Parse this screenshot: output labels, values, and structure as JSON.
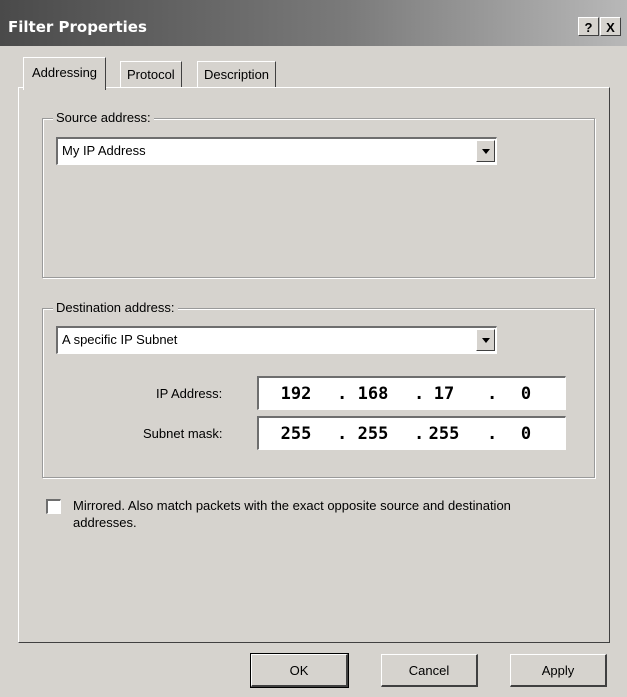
{
  "window": {
    "title": "Filter Properties",
    "help_label": "?",
    "close_label": "X"
  },
  "tabs": [
    {
      "label": "Addressing",
      "active": true
    },
    {
      "label": "Protocol",
      "active": false
    },
    {
      "label": "Description",
      "active": false
    }
  ],
  "source": {
    "legend": "Source address:",
    "selected": "My IP Address"
  },
  "destination": {
    "legend": "Destination address:",
    "selected": "A specific IP Subnet",
    "ip_label": "IP Address:",
    "ip_octets": [
      "192",
      "168",
      "17",
      "0"
    ],
    "mask_label": "Subnet mask:",
    "mask_octets": [
      "255",
      "255",
      "255",
      "0"
    ],
    "octet_separator": "."
  },
  "mirrored": {
    "checked": false,
    "label": "Mirrored. Also match packets with the exact opposite source and destination addresses."
  },
  "buttons": {
    "ok": "OK",
    "cancel": "Cancel",
    "apply": "Apply"
  }
}
